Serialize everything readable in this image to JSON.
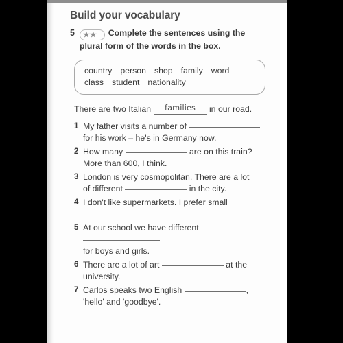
{
  "page": {
    "section_title": "Build your vocabulary",
    "exercise": {
      "number": "5",
      "difficulty_stars": "★★",
      "instruction_line1": "Complete the sentences using the",
      "instruction_line2": "plural form of the words in the box."
    },
    "word_box": {
      "row1": [
        {
          "word": "country",
          "used": false
        },
        {
          "word": "person",
          "used": false
        },
        {
          "word": "shop",
          "used": false
        },
        {
          "word": "family",
          "used": true
        },
        {
          "word": "word",
          "used": false
        }
      ],
      "row2": [
        {
          "word": "class",
          "used": false
        },
        {
          "word": "student",
          "used": false
        },
        {
          "word": "nationality",
          "used": false
        }
      ]
    },
    "example": {
      "before": "There are two Italian",
      "answer": "families",
      "after": "in our road."
    },
    "questions": [
      {
        "number": "1",
        "line1_before": "My father visits a number of",
        "line1_after": "",
        "line2": "for his work – he's in Germany now."
      },
      {
        "number": "2",
        "line1_before": "How many",
        "line1_after": "are on this train?",
        "line2": "More than 600, I think."
      },
      {
        "number": "3",
        "line1_before": "London is very cosmopolitan. There are a lot",
        "line1_after": "",
        "line2_before": "of different",
        "line2_after": "in the city."
      },
      {
        "number": "4",
        "line1_before": "I don't like supermarkets. I prefer small",
        "line1_after": "",
        "line2": ""
      },
      {
        "number": "5",
        "line1_before": "At our school we have different",
        "line1_after": "",
        "line2": "for boys and girls."
      },
      {
        "number": "6",
        "line1_before": "There are a lot of art",
        "line1_after": "at the",
        "line2": "university."
      },
      {
        "number": "7",
        "line1_before": "Carlos speaks two English",
        "line1_after": ",",
        "line2": "'hello' and 'goodbye'."
      }
    ]
  }
}
